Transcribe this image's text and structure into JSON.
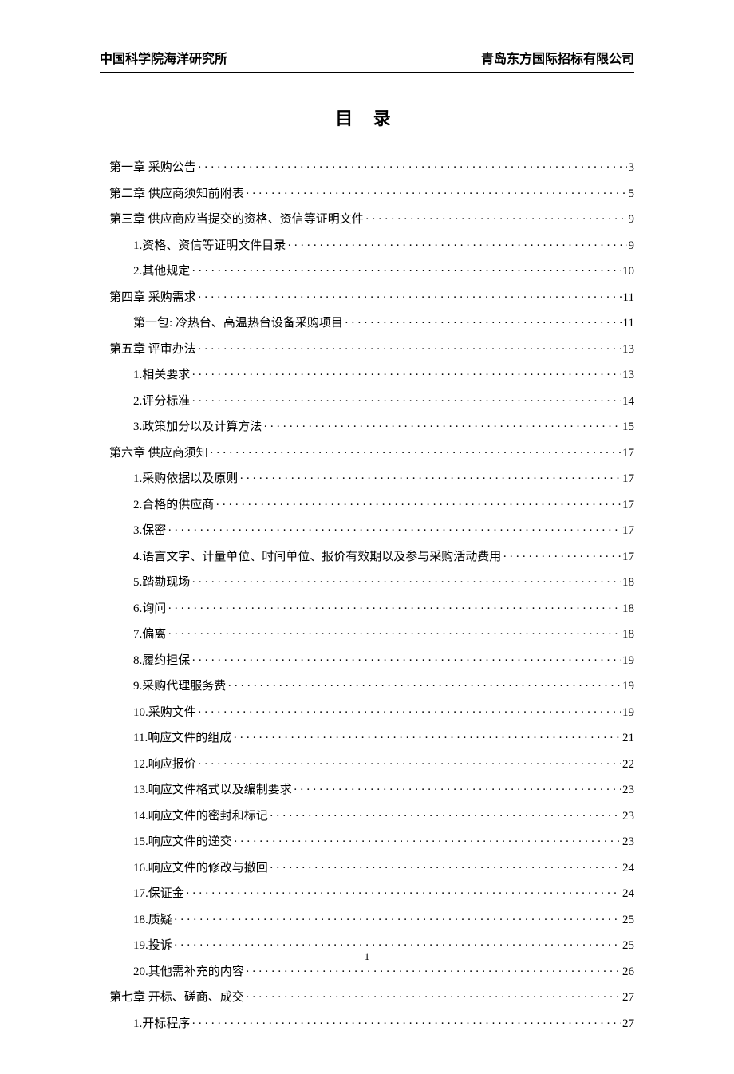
{
  "header": {
    "left": "中国科学院海洋研究所",
    "right": "青岛东方国际招标有限公司"
  },
  "title": "目  录",
  "footer_page": "1",
  "toc": [
    {
      "level": 0,
      "label": "第一章   采购公告",
      "page": "3"
    },
    {
      "level": 0,
      "label": "第二章   供应商须知前附表",
      "page": "5"
    },
    {
      "level": 0,
      "label": "第三章   供应商应当提交的资格、资信等证明文件",
      "page": "9"
    },
    {
      "level": 1,
      "label": "1.资格、资信等证明文件目录",
      "page": "9"
    },
    {
      "level": 1,
      "label": "2.其他规定",
      "page": "10"
    },
    {
      "level": 0,
      "label": "第四章   采购需求",
      "page": "11"
    },
    {
      "level": 1,
      "label": "第一包: 冷热台、高温热台设备采购项目",
      "page": "11"
    },
    {
      "level": 0,
      "label": "第五章   评审办法",
      "page": "13"
    },
    {
      "level": 1,
      "label": "1.相关要求",
      "page": "13"
    },
    {
      "level": 1,
      "label": "2.评分标准",
      "page": "14"
    },
    {
      "level": 1,
      "label": "3.政策加分以及计算方法",
      "page": "15"
    },
    {
      "level": 0,
      "label": "第六章   供应商须知",
      "page": "17"
    },
    {
      "level": 1,
      "label": "1.采购依据以及原则",
      "page": "17"
    },
    {
      "level": 1,
      "label": "2.合格的供应商",
      "page": "17"
    },
    {
      "level": 1,
      "label": "3.保密",
      "page": "17"
    },
    {
      "level": 1,
      "label": "4.语言文字、计量单位、时间单位、报价有效期以及参与采购活动费用",
      "page": "17"
    },
    {
      "level": 1,
      "label": "5.踏勘现场",
      "page": "18"
    },
    {
      "level": 1,
      "label": "6.询问",
      "page": "18"
    },
    {
      "level": 1,
      "label": "7.偏离",
      "page": "18"
    },
    {
      "level": 1,
      "label": "8.履约担保",
      "page": "19"
    },
    {
      "level": 1,
      "label": "9.采购代理服务费",
      "page": "19"
    },
    {
      "level": 1,
      "label": "10.采购文件",
      "page": "19"
    },
    {
      "level": 1,
      "label": "11.响应文件的组成",
      "page": "21"
    },
    {
      "level": 1,
      "label": "12.响应报价",
      "page": "22"
    },
    {
      "level": 1,
      "label": "13.响应文件格式以及编制要求",
      "page": "23"
    },
    {
      "level": 1,
      "label": "14.响应文件的密封和标记",
      "page": "23"
    },
    {
      "level": 1,
      "label": "15.响应文件的递交",
      "page": "23"
    },
    {
      "level": 1,
      "label": "16.响应文件的修改与撤回",
      "page": "24"
    },
    {
      "level": 1,
      "label": "17.保证金",
      "page": "24"
    },
    {
      "level": 1,
      "label": "18.质疑",
      "page": "25"
    },
    {
      "level": 1,
      "label": "19.投诉",
      "page": "25"
    },
    {
      "level": 1,
      "label": "20.其他需补充的内容",
      "page": "26"
    },
    {
      "level": 0,
      "label": "第七章   开标、磋商、成交",
      "page": "27"
    },
    {
      "level": 1,
      "label": "1.开标程序",
      "page": "27"
    }
  ]
}
